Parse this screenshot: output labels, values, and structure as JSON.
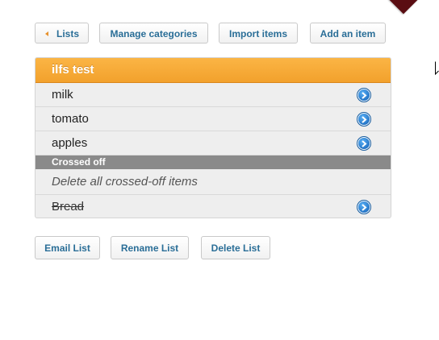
{
  "toolbar": {
    "back_label": "Lists",
    "manage_label": "Manage categories",
    "import_label": "Import items",
    "add_label": "Add an item"
  },
  "list": {
    "title": "ilfs test",
    "items": [
      {
        "label": "milk"
      },
      {
        "label": "tomato"
      },
      {
        "label": "apples"
      }
    ],
    "crossed_header": "Crossed off",
    "delete_crossed_label": "Delete all crossed-off items",
    "crossed_items": [
      {
        "label": "Bread"
      }
    ]
  },
  "actions": {
    "email_label": "Email List",
    "rename_label": "Rename List",
    "delete_label": "Delete List"
  },
  "icons": {
    "back": "back-arrow-icon",
    "detail": "detail-disclosure-icon",
    "cursor": "mouse-pointer-icon"
  },
  "colors": {
    "accent": "#f2a12c",
    "button_text": "#2a6e97",
    "crossed_header_bg": "#8a8a8a",
    "detail_icon": "#1f6fc2",
    "corner_tip": "#5a0d12"
  }
}
